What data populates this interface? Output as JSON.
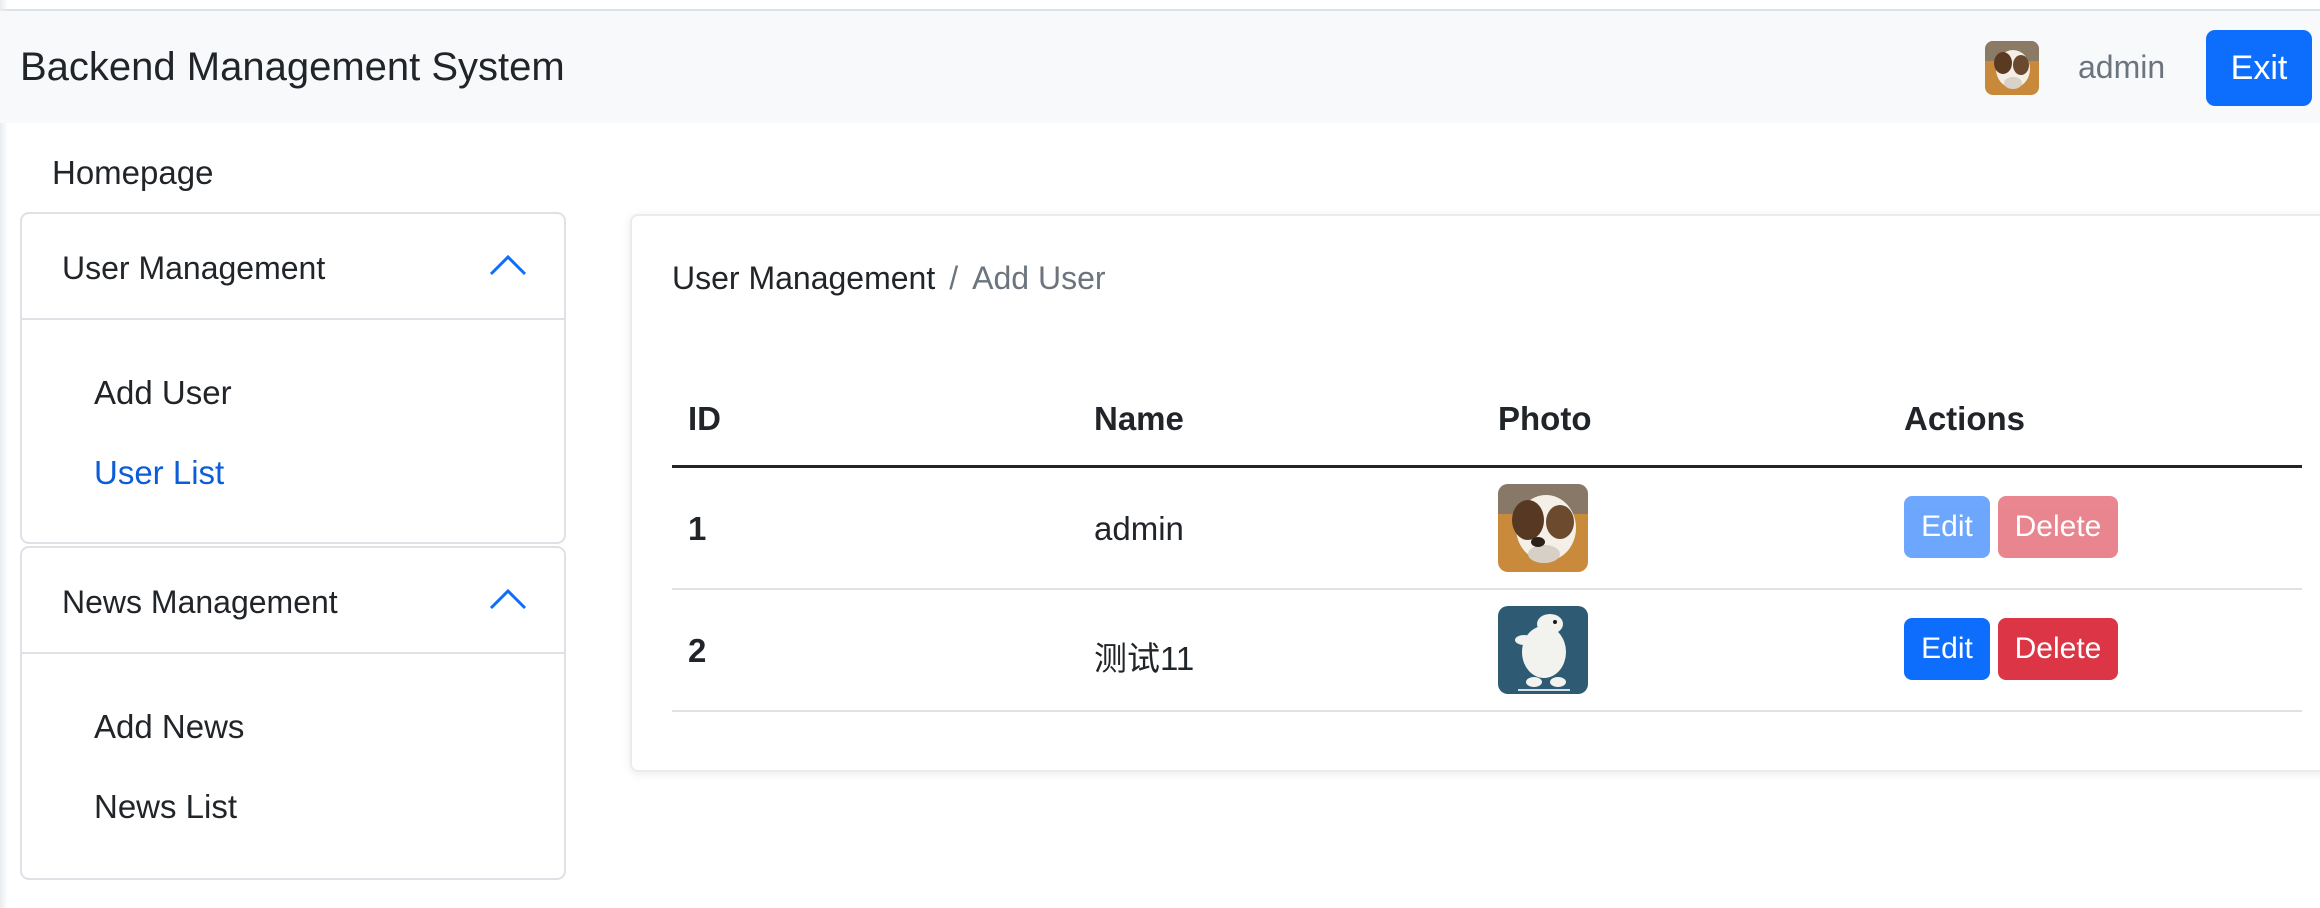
{
  "navbar": {
    "brand": "Backend Management System",
    "username": "admin",
    "exit_label": "Exit"
  },
  "sidebar": {
    "homepage": "Homepage",
    "sections": [
      {
        "title": "User Management",
        "items": [
          {
            "label": "Add User"
          },
          {
            "label": "User List",
            "active": true
          }
        ]
      },
      {
        "title": "News Management",
        "items": [
          {
            "label": "Add News"
          },
          {
            "label": "News List"
          }
        ]
      }
    ]
  },
  "main": {
    "breadcrumb": {
      "parent": "User Management",
      "separator": "/",
      "current": "Add User"
    },
    "table": {
      "columns": [
        "ID",
        "Name",
        "Photo",
        "Actions"
      ],
      "rows": [
        {
          "id": "1",
          "name": "admin",
          "photo_icon": "cat-photo",
          "edit_label": "Edit",
          "delete_label": "Delete",
          "actions_disabled": true
        },
        {
          "id": "2",
          "name": "测试11",
          "photo_icon": "polar-bear-photo",
          "edit_label": "Edit",
          "delete_label": "Delete",
          "actions_disabled": false
        }
      ]
    }
  },
  "colors": {
    "primary": "#0d6efd",
    "danger": "#dc3545",
    "active_link": "#0b5ed7",
    "navbar_bg": "#f8f9fa"
  }
}
